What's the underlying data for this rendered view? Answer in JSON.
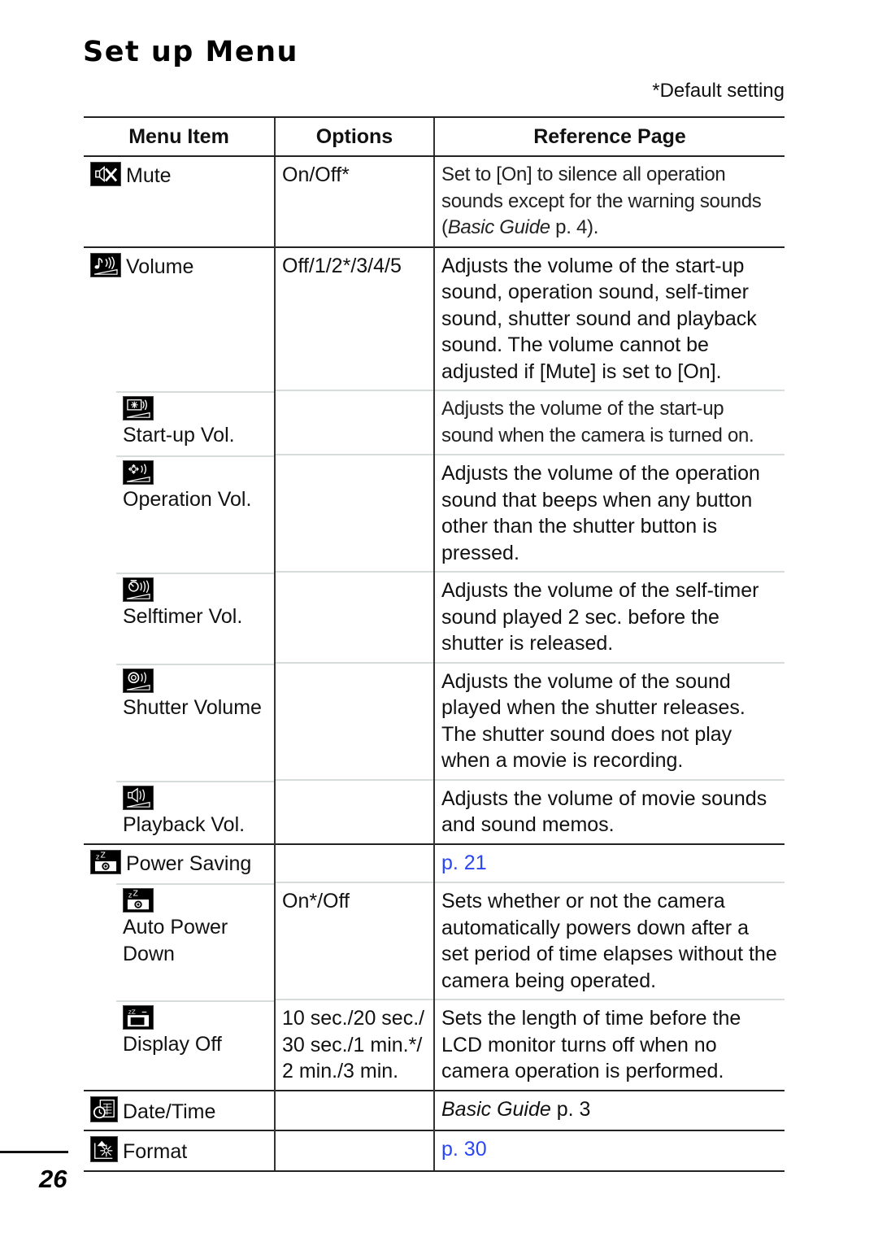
{
  "page": {
    "title": "Set up Menu",
    "default_note": "*Default setting",
    "page_number": "26"
  },
  "table": {
    "headers": [
      "Menu Item",
      "Options",
      "Reference Page"
    ],
    "rows": [
      {
        "item": "Mute",
        "icon": "mute-speaker-icon",
        "options": "On/Off*",
        "reference": "Set to [On] to silence all operation sounds except for the warning sounds (",
        "ref_italic": "Basic Guide",
        "ref_suffix": " p. 4)."
      },
      {
        "item": "Volume",
        "icon": "volume-note-icon",
        "options": "Off/1/2*/3/4/5",
        "reference": "Adjusts the volume of the start-up sound, operation sound, self-timer sound, shutter sound and playback sound. The volume cannot be adjusted if [Mute] is set to [On]."
      },
      {
        "item": "Start-up Vol.",
        "icon": "startup-volume-icon",
        "options": "",
        "reference": "Adjusts the volume of the start-up sound when the camera is turned on."
      },
      {
        "item": "Operation Vol.",
        "icon": "operation-volume-icon",
        "options": "",
        "reference": "Adjusts the volume of the operation sound that beeps when any button other than the shutter button is pressed."
      },
      {
        "item": "Selftimer Vol.",
        "icon": "selftimer-volume-icon",
        "options": "",
        "reference": "Adjusts the volume of the self-timer sound played 2 sec. before the shutter is released."
      },
      {
        "item": "Shutter Volume",
        "icon": "shutter-volume-icon",
        "options": "",
        "reference": "Adjusts the volume of the sound played when the shutter releases. The shutter sound does not play when a movie is recording."
      },
      {
        "item": "Playback Vol.",
        "icon": "playback-volume-icon",
        "options": "",
        "reference": "Adjusts the volume of movie sounds and sound memos."
      },
      {
        "item": "Power Saving",
        "icon": "power-saving-icon",
        "options": "",
        "reference": "p. 21"
      },
      {
        "item": "Auto Power Down",
        "icon": "auto-power-down-icon",
        "options": "On*/Off",
        "reference": "Sets whether or not the camera automatically powers down after a set period of time elapses without the camera being operated."
      },
      {
        "item": "Display Off",
        "icon": "display-off-icon",
        "options": "10 sec./20 sec./ 30 sec./1 min.*/ 2 min./3 min.",
        "reference": "Sets the length of time before the LCD monitor turns off when no camera operation is performed."
      },
      {
        "item": "Date/Time",
        "icon": "date-time-icon",
        "options": "",
        "reference": "Basic Guide",
        "ref_suffix": " p. 3"
      },
      {
        "item": "Format",
        "icon": "format-icon",
        "options": "",
        "reference": "p. 30"
      }
    ]
  },
  "colors": {
    "link": "#2a46f5",
    "text": "#111111",
    "rule_major": "#222222",
    "rule_minor": "#d6dcdc"
  }
}
